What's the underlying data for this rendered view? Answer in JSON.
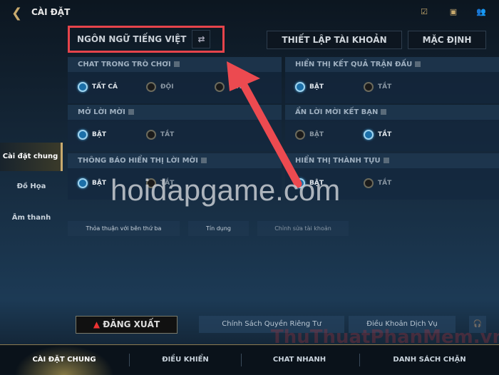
{
  "header": {
    "back_icon": "back-chevron-icon",
    "title": "CÀI ĐẶT",
    "icons": [
      "mission-icon",
      "chat-icon",
      "friends-icon"
    ]
  },
  "language": {
    "label": "NGÔN NGỮ TIẾNG VIỆT",
    "swap_icon": "swap-arrows-icon"
  },
  "top_buttons": {
    "account": "THIẾT LẬP TÀI KHOẢN",
    "default": "MẶC ĐỊNH"
  },
  "sections": [
    {
      "title": "CHAT TRONG TRÒ CHƠI",
      "options": [
        {
          "label": "TẤT CẢ",
          "selected": true
        },
        {
          "label": "ĐỘI",
          "selected": false
        },
        {
          "label": "TẮT",
          "selected": false
        }
      ]
    },
    {
      "title": "HIỂN THỊ KẾT QUẢ TRẬN ĐẤU",
      "options": [
        {
          "label": "BẬT",
          "selected": true
        },
        {
          "label": "TẮT",
          "selected": false
        }
      ]
    },
    {
      "title": "MỞ LỜI MỜI",
      "options": [
        {
          "label": "BẬT",
          "selected": true
        },
        {
          "label": "TẮT",
          "selected": false
        }
      ]
    },
    {
      "title": "ẨN LỜI MỜI KẾT BẠN",
      "options": [
        {
          "label": "BẬT",
          "selected": false
        },
        {
          "label": "TẮT",
          "selected": true
        }
      ]
    },
    {
      "title": "THÔNG BÁO HIỂN THỊ LỜI MỜI",
      "options": [
        {
          "label": "BẬT",
          "selected": true
        },
        {
          "label": "TẮT",
          "selected": false
        }
      ]
    },
    {
      "title": "HIỂN THỊ THÀNH TỰU",
      "options": [
        {
          "label": "BẬT",
          "selected": true
        },
        {
          "label": "TẮT",
          "selected": false
        }
      ]
    }
  ],
  "sidebar": {
    "items": [
      {
        "label": "Cài đặt chung",
        "active": true
      },
      {
        "label": "Đồ Họa"
      },
      {
        "label": "Âm thanh"
      }
    ]
  },
  "small_buttons": [
    "Thỏa thuận với bên thứ ba",
    "Tín dụng",
    "Chỉnh sửa tài khoản"
  ],
  "bottom_buttons": {
    "logout": "ĐĂNG XUẤT",
    "privacy": "Chính Sách Quyền Riêng Tư",
    "terms": "Điều Khoản Dịch Vụ",
    "support_icon": "headset-icon"
  },
  "nav": {
    "items": [
      "CÀI ĐẶT CHUNG",
      "ĐIỀU KHIỂN",
      "CHAT NHANH",
      "DANH SÁCH CHẶN"
    ],
    "active": 0
  },
  "watermarks": {
    "main": "hoidapgame.com",
    "corner": "ThuThuatPhanMem.vn"
  },
  "colors": {
    "accent_gold": "#c8aa6e",
    "highlight_red": "#e6444b",
    "radio_on": "#1b6fa8"
  }
}
